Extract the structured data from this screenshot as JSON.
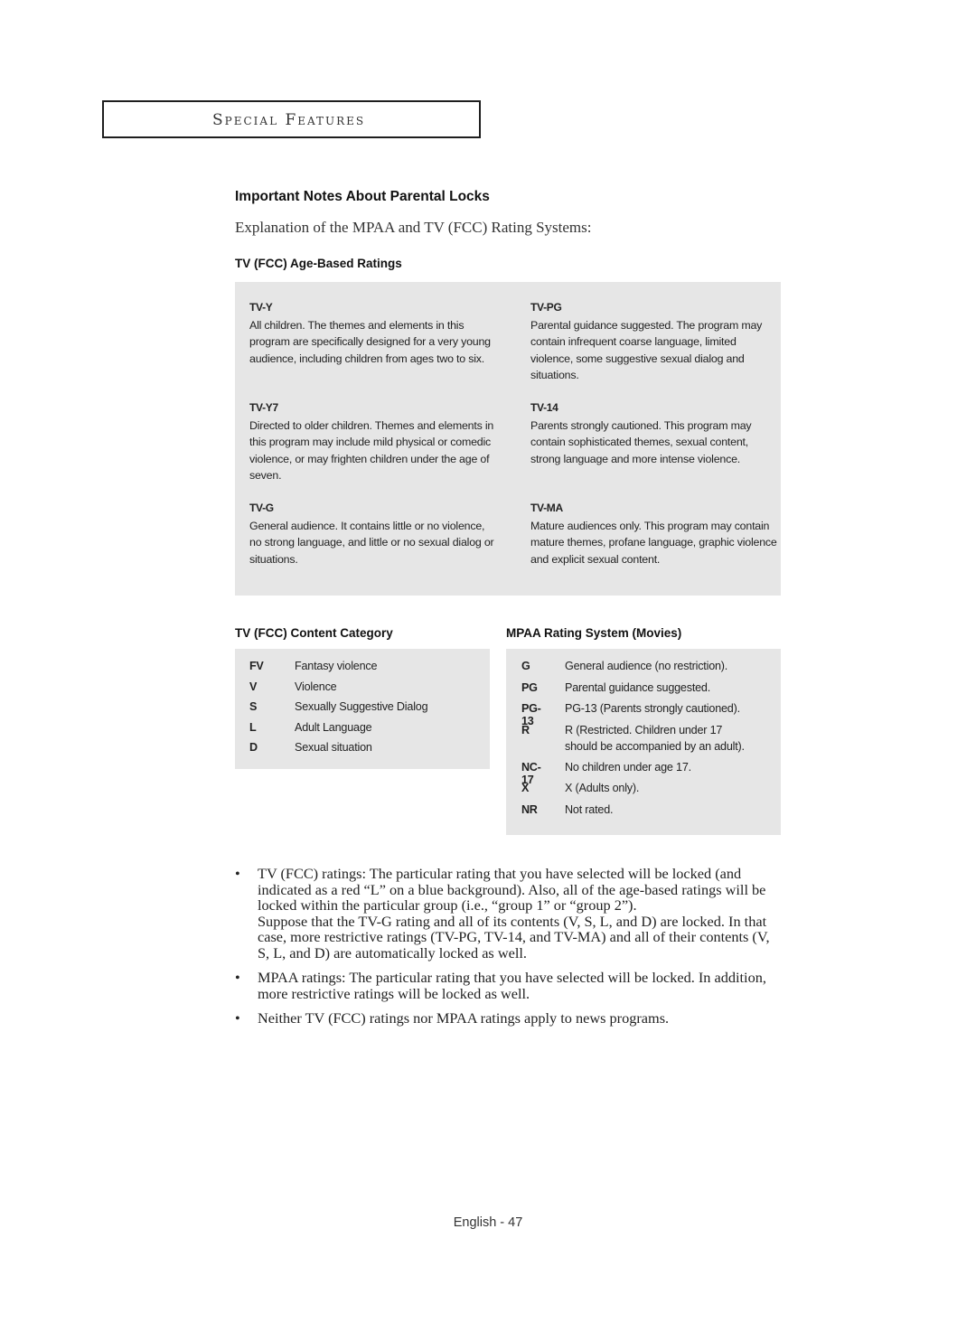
{
  "section_header": "Special Features",
  "title": "Important Notes About Parental Locks",
  "subtitle": "Explanation of the MPAA and TV (FCC) Rating Systems:",
  "age_based": {
    "heading": "TV (FCC) Age-Based Ratings",
    "ratings": [
      {
        "code": "TV-Y",
        "text": "All children. The themes and elements in this program are specifically designed for a very young audience, including children from ages two to six."
      },
      {
        "code": "TV-PG",
        "text": "Parental guidance suggested. The program may contain infrequent coarse language, limited violence, some suggestive sexual dialog and situations."
      },
      {
        "code": "TV-Y7",
        "text": "Directed to older children. Themes and elements in this program may include mild physical or comedic violence, or may frighten children under the age of seven."
      },
      {
        "code": "TV-14",
        "text": "Parents strongly cautioned. This program may contain sophisticated themes, sexual content, strong language and more intense violence."
      },
      {
        "code": "TV-G",
        "text": "General audience.  It contains little or no violence, no strong language, and little or no sexual dialog or situations."
      },
      {
        "code": "TV-MA",
        "text": "Mature audiences only. This program may contain mature themes, profane language, graphic violence and explicit sexual content."
      }
    ]
  },
  "content_category": {
    "heading": "TV (FCC) Content Category",
    "items": [
      {
        "code": "FV",
        "text": "Fantasy violence"
      },
      {
        "code": "V",
        "text": "Violence"
      },
      {
        "code": "S",
        "text": "Sexually Suggestive Dialog"
      },
      {
        "code": "L",
        "text": "Adult Language"
      },
      {
        "code": "D",
        "text": "Sexual situation"
      }
    ]
  },
  "mpaa": {
    "heading": "MPAA Rating System (Movies)",
    "items": [
      {
        "code": "G",
        "text": "General audience (no restriction)."
      },
      {
        "code": "PG",
        "text": "Parental guidance suggested."
      },
      {
        "code": "PG-13",
        "text": "PG-13 (Parents strongly cautioned)."
      },
      {
        "code": "R",
        "text": "R (Restricted. Children under 17",
        "text2": "should be accompanied by an adult)."
      },
      {
        "code": "NC-17",
        "text": "No children under age 17."
      },
      {
        "code": "X",
        "text": "X (Adults only)."
      },
      {
        "code": "NR",
        "text": "Not rated."
      }
    ]
  },
  "notes": [
    {
      "bullet": "•",
      "p1": "TV (FCC) ratings: The particular rating that you have selected will be locked (and indicated as a red “L” on a blue background). Also, all of the age-based ratings will be locked within the particular group (i.e., “group 1” or “group 2”).",
      "p2": "Suppose that the TV-G rating and all of its contents (V, S, L, and D) are locked. In that case, more restrictive ratings (TV-PG, TV-14, and TV-MA) and all of their contents (V, S, L, and D) are automatically locked as well."
    },
    {
      "bullet": "•",
      "p1": "MPAA ratings: The particular rating that you have selected will be locked. In addition, more restrictive ratings will be locked as well."
    },
    {
      "bullet": "•",
      "p1": "Neither TV (FCC) ratings nor MPAA ratings apply to news programs."
    }
  ],
  "footer": "English - 47"
}
